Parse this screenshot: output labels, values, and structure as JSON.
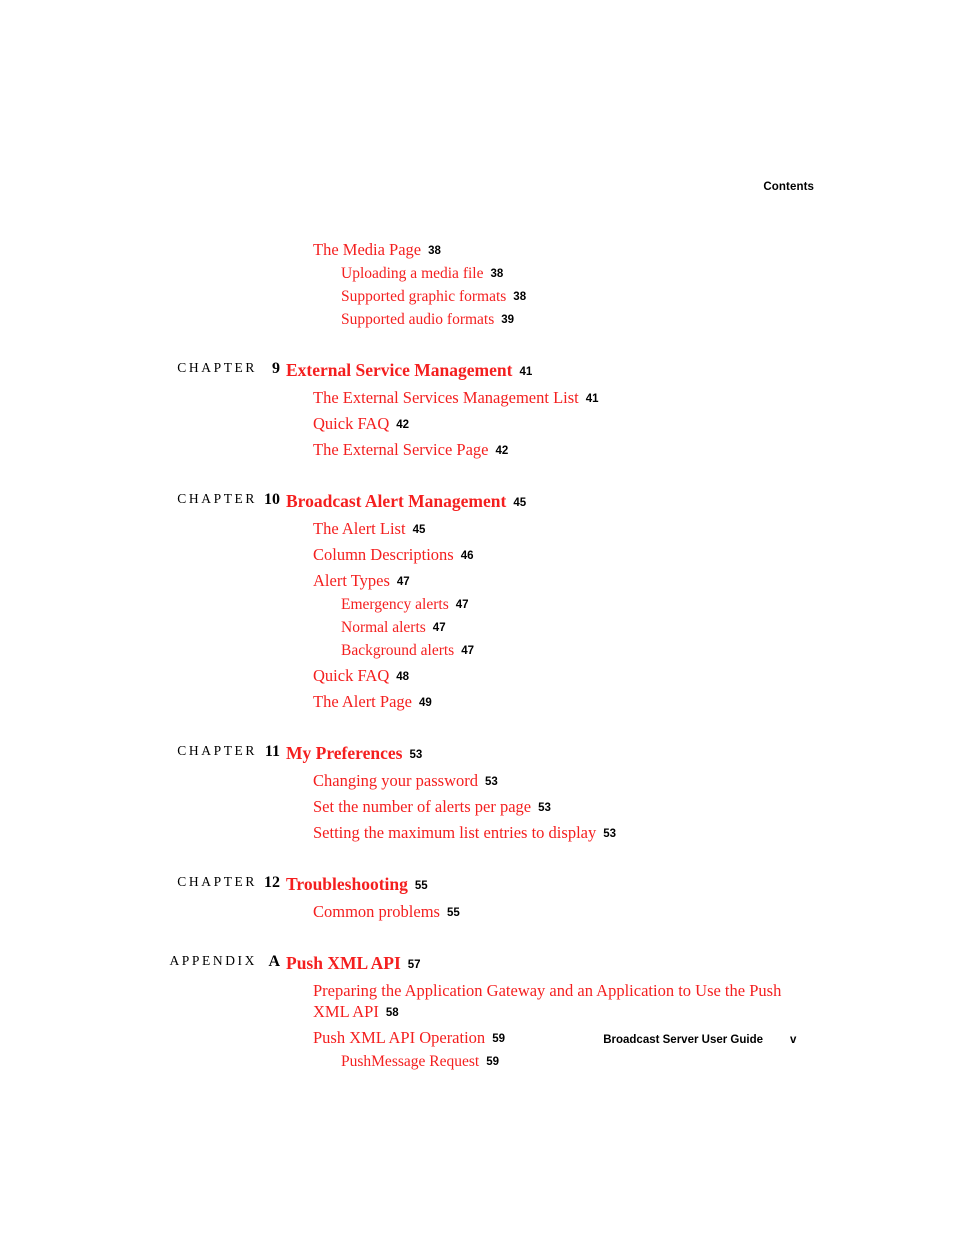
{
  "header": {
    "running_head": "Contents"
  },
  "footer": {
    "book_title": "Broadcast Server User Guide",
    "folio": "v"
  },
  "toc": {
    "orphan_entries": [
      {
        "level": 1,
        "text": "The Media Page",
        "page": "38"
      },
      {
        "level": 2,
        "text": "Uploading a media file",
        "page": "38"
      },
      {
        "level": 2,
        "text": "Supported graphic formats",
        "page": "38"
      },
      {
        "level": 2,
        "text": "Supported audio formats",
        "page": "39"
      }
    ],
    "chapters": [
      {
        "kicker": "CHAPTER",
        "number": "9",
        "title": "External Service Management",
        "page": "41",
        "entries": [
          {
            "level": 1,
            "text": "The External Services Management List",
            "page": "41"
          },
          {
            "level": 1,
            "text": "Quick FAQ",
            "page": "42"
          },
          {
            "level": 1,
            "text": "The External Service Page",
            "page": "42"
          }
        ]
      },
      {
        "kicker": "CHAPTER",
        "number": "10",
        "title": "Broadcast Alert Management",
        "page": "45",
        "entries": [
          {
            "level": 1,
            "text": "The Alert List",
            "page": "45"
          },
          {
            "level": 1,
            "text": "Column Descriptions",
            "page": "46"
          },
          {
            "level": 1,
            "text": "Alert Types",
            "page": "47"
          },
          {
            "level": 2,
            "text": "Emergency alerts",
            "page": "47"
          },
          {
            "level": 2,
            "text": "Normal alerts",
            "page": "47"
          },
          {
            "level": 2,
            "text": "Background alerts",
            "page": "47"
          },
          {
            "level": 1,
            "text": "Quick FAQ",
            "page": "48"
          },
          {
            "level": 1,
            "text": "The Alert Page",
            "page": "49"
          }
        ]
      },
      {
        "kicker": "CHAPTER",
        "number": "11",
        "title": "My Preferences",
        "page": "53",
        "entries": [
          {
            "level": 1,
            "text": "Changing your password",
            "page": "53"
          },
          {
            "level": 1,
            "text": "Set the number of alerts per page",
            "page": "53"
          },
          {
            "level": 1,
            "text": "Setting the maximum list entries to display",
            "page": "53"
          }
        ]
      },
      {
        "kicker": "CHAPTER",
        "number": "12",
        "title": "Troubleshooting",
        "page": "55",
        "entries": [
          {
            "level": 1,
            "text": "Common problems",
            "page": "55"
          }
        ]
      },
      {
        "kicker": "APPENDIX",
        "number": "A",
        "title": "Push XML API",
        "page": "57",
        "entries": [
          {
            "level": 1,
            "text": "Preparing the Application Gateway and an Application to Use the Push XML API",
            "page": "58",
            "wrap": true
          },
          {
            "level": 1,
            "text": "Push XML API Operation",
            "page": "59"
          },
          {
            "level": 2,
            "text": "PushMessage Request",
            "page": "59"
          }
        ]
      }
    ]
  }
}
